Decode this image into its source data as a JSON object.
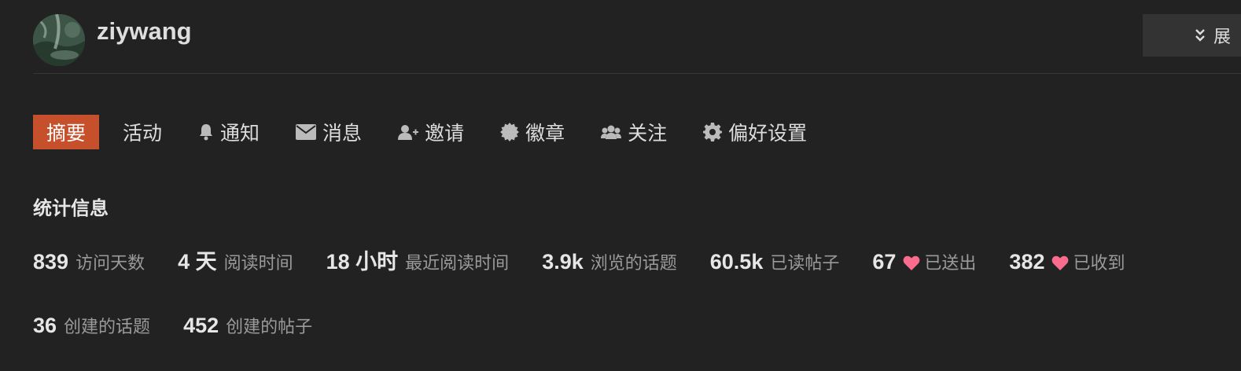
{
  "user": {
    "username": "ziywang"
  },
  "header": {
    "expand_label": "展"
  },
  "nav": [
    {
      "label": "摘要",
      "icon": "",
      "active": true
    },
    {
      "label": "活动",
      "icon": "",
      "active": false
    },
    {
      "label": "通知",
      "icon": "bell-icon",
      "active": false
    },
    {
      "label": "消息",
      "icon": "envelope-icon",
      "active": false
    },
    {
      "label": "邀请",
      "icon": "user-plus-icon",
      "active": false
    },
    {
      "label": "徽章",
      "icon": "badge-icon",
      "active": false
    },
    {
      "label": "关注",
      "icon": "users-icon",
      "active": false
    },
    {
      "label": "偏好设置",
      "icon": "gear-icon",
      "active": false
    }
  ],
  "stats": {
    "title": "统计信息",
    "row1": [
      {
        "value": "839",
        "label": "访问天数"
      },
      {
        "value": "4 天",
        "label": "阅读时间"
      },
      {
        "value": "18 小时",
        "label": "最近阅读时间"
      },
      {
        "value": "3.9k",
        "label": "浏览的话题"
      },
      {
        "value": "60.5k",
        "label": "已读帖子"
      },
      {
        "value": "67",
        "label": "已送出",
        "icon": "heart-icon"
      },
      {
        "value": "382",
        "label": "已收到",
        "icon": "heart-icon"
      }
    ],
    "row2": [
      {
        "value": "36",
        "label": "创建的话题"
      },
      {
        "value": "452",
        "label": "创建的帖子"
      }
    ]
  },
  "colors": {
    "background": "#222222",
    "accent": "#c6502b",
    "heart": "#fa6c8d",
    "muted_text": "#9a9a9a"
  }
}
